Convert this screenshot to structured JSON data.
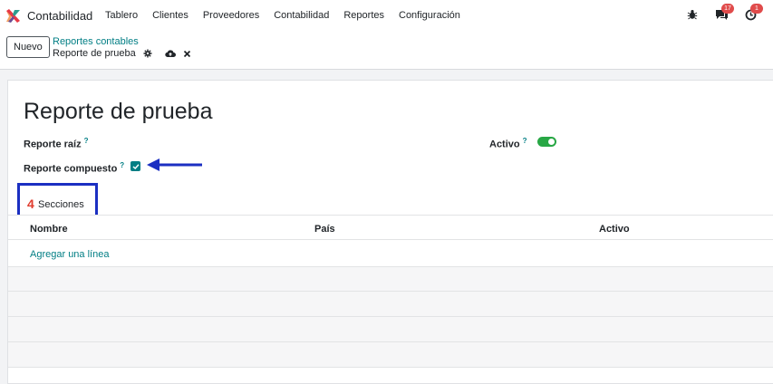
{
  "navbar": {
    "app_name": "Contabilidad",
    "menu": [
      "Tablero",
      "Clientes",
      "Proveedores",
      "Contabilidad",
      "Reportes",
      "Configuración"
    ],
    "messages_badge": "17",
    "activity_badge": "1"
  },
  "control": {
    "new_button": "Nuevo",
    "breadcrumb_parent": "Reportes contables",
    "breadcrumb_current": "Reporte de prueba"
  },
  "form": {
    "title": "Reporte de prueba",
    "root_report_label": "Reporte raíz",
    "composite_report_label": "Reporte compuesto",
    "composite_report_checked": true,
    "active_label": "Activo",
    "active_on": true,
    "help_marker": "?"
  },
  "tab": {
    "number": "4",
    "label": "Secciones"
  },
  "list": {
    "columns": [
      "Nombre",
      "País",
      "Activo"
    ],
    "add_line": "Agregar una línea"
  },
  "colors": {
    "accent": "#017e84",
    "highlight": "#1b2fc2",
    "toggle_on": "#28a745",
    "badge": "#e04b4b"
  },
  "icons": [
    "app-logo",
    "bug-icon",
    "chat-icon",
    "clock-icon",
    "gear-icon",
    "cloud-upload-icon",
    "close-icon",
    "check-icon",
    "arrow-left-icon"
  ]
}
